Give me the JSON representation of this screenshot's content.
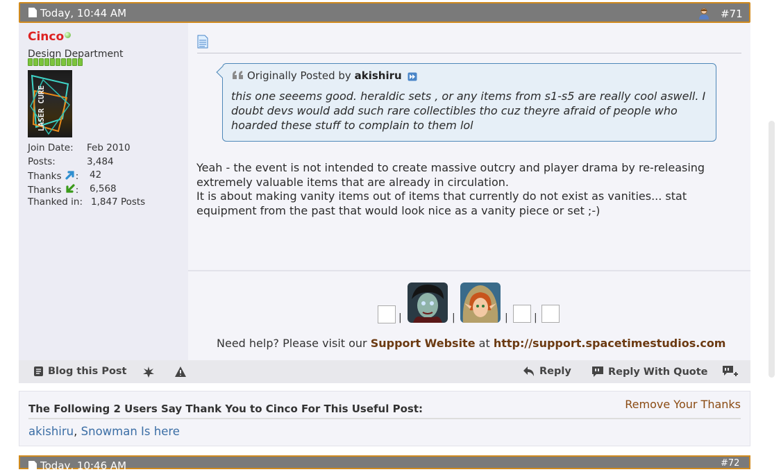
{
  "post": {
    "date": "Today, 10:44 AM",
    "number": "#71"
  },
  "user": {
    "name": "Cinco",
    "title": "Design Department",
    "avatar_text": "LASER CURE",
    "stats": [
      {
        "label": "Join Date:",
        "value": "Feb 2010"
      },
      {
        "label": "Posts:",
        "value": "3,484"
      },
      {
        "label": "Thanks",
        "suffix": ":",
        "value": "42",
        "icon": "arrow-up-right-icon"
      },
      {
        "label": "Thanks",
        "suffix": ":",
        "value": "6,568",
        "icon": "arrow-down-left-icon"
      },
      {
        "label": "Thanked in:",
        "value": "1,847 Posts"
      }
    ]
  },
  "quote": {
    "prefix": "Originally Posted by",
    "author": "akishiru",
    "text": "this one seeems good. heraldic sets , or any items from s1-s5 are really cool aswell. I doubt devs would add such rare collectibles tho cuz theyre afraid of people who hoarded these stuff to complain to them lol"
  },
  "message": {
    "paragraphs": [
      "Yeah - the event is not intended to create massive outcry and player drama by re-releasing extremely valuable items that are already in circulation.",
      "It is about making vanity items out of items that currently do not exist as vanities... stat equipment from the past that would look nice as a vanity piece or set ;-)"
    ]
  },
  "signature": {
    "separator": "|",
    "help_prefix": "Need help? Please visit our",
    "support_label": "Support Website",
    "at": "at",
    "support_url": "http://support.spacetimestudios.com"
  },
  "actions": {
    "blog": "Blog this Post",
    "reply": "Reply",
    "reply_quote": "Reply With Quote"
  },
  "thanks": {
    "title": "The Following 2 Users Say Thank You to Cinco For This Useful Post:",
    "remove": "Remove Your Thanks",
    "users": [
      "akishiru",
      "Snowman Is here"
    ],
    "separator": ","
  },
  "next_post": {
    "date": "Today, 10:46 AM",
    "number": "#72"
  },
  "colors": {
    "header_bg": "#7a7a7a",
    "header_border": "#d08a1e",
    "username": "#dd2222",
    "link": "#3b6ea5",
    "support_link": "#6b3a12"
  }
}
